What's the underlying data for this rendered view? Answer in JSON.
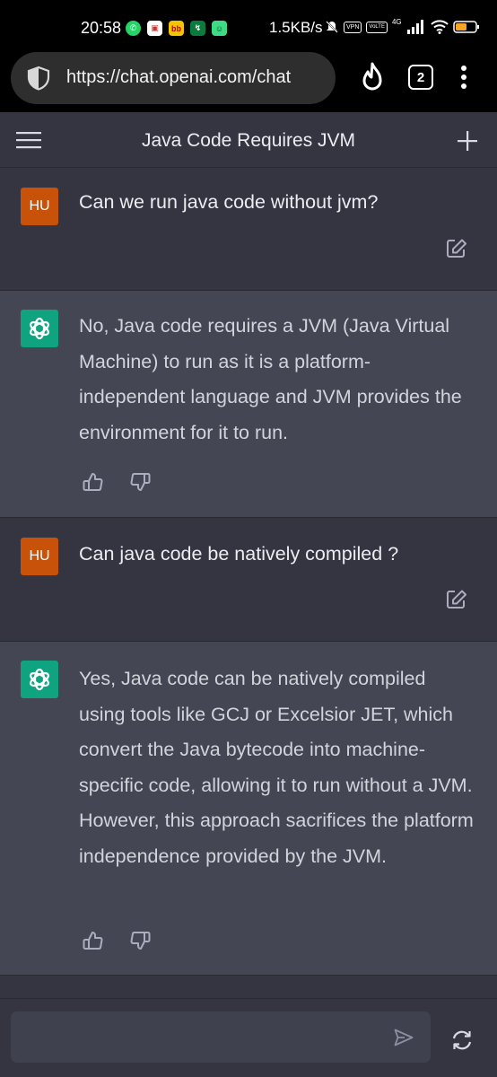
{
  "status_bar": {
    "time": "20:58",
    "net_speed": "1.5KB/s",
    "vpn": "VPN",
    "volte": "VoLTE",
    "network": "4G"
  },
  "browser": {
    "url": "https://chat.openai.com/chat",
    "tab_count": "2"
  },
  "header": {
    "title": "Java Code Requires JVM"
  },
  "messages": [
    {
      "role": "user",
      "avatar": "HU",
      "text": "Can we run java code without jvm?"
    },
    {
      "role": "assistant",
      "text": "No, Java code requires a JVM (Java Virtual Machine) to run as it is a platform-independent language and JVM provides the environment for it to run."
    },
    {
      "role": "user",
      "avatar": "HU",
      "text": "Can java code be natively compiled ?"
    },
    {
      "role": "assistant",
      "text": "Yes, Java code can be natively compiled using tools like GCJ or Excelsior JET, which convert the Java bytecode into machine-specific code, allowing it to run without a JVM. However, this approach sacrifices the platform independence provided by the JVM."
    }
  ],
  "composer": {
    "placeholder": ""
  },
  "colors": {
    "user_avatar": "#c9520a",
    "gpt_avatar": "#10a37f",
    "assistant_bg": "#444654",
    "user_bg": "#343541"
  }
}
